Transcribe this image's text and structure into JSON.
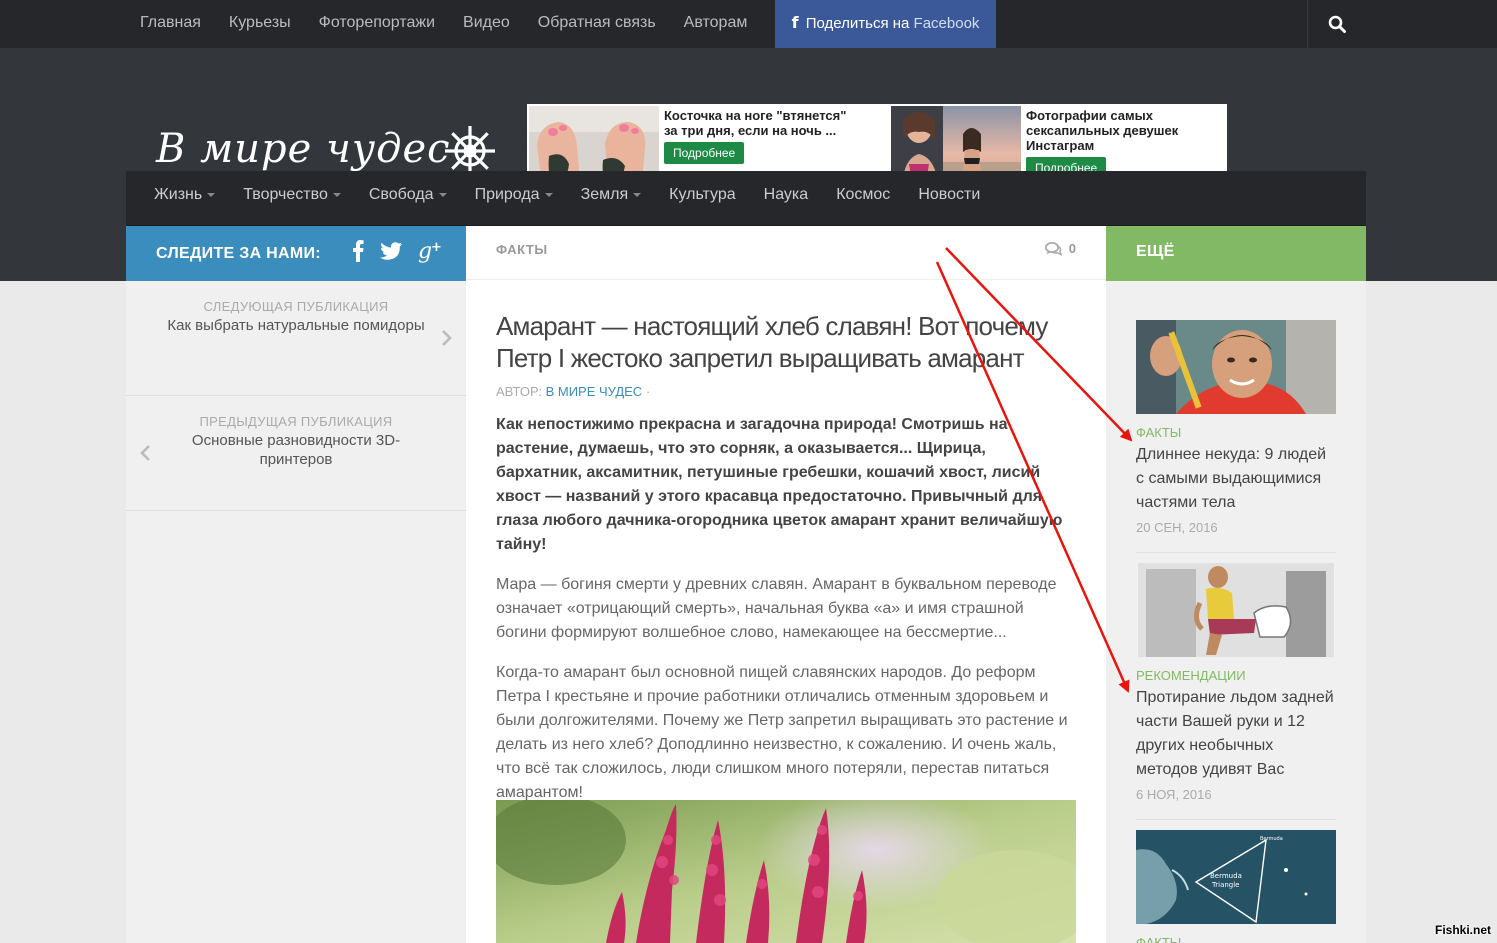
{
  "topnav": {
    "items": [
      "Главная",
      "Курьезы",
      "Фоторепортажи",
      "Видео",
      "Обратная связь",
      "Авторам"
    ],
    "share_prefix": "Поделиться на",
    "share_network": "Facebook"
  },
  "header": {
    "logo_text": "В мире чудес"
  },
  "ads": [
    {
      "title": "Косточка на ноге \"втянется\" за три дня, если на ночь ...",
      "button": "Подробнее"
    },
    {
      "title": "Фотографии самых сексапильных девушек Инстаграм",
      "button": "Подробнее"
    }
  ],
  "mainnav": {
    "items": [
      {
        "label": "Жизнь",
        "dropdown": true
      },
      {
        "label": "Творчество",
        "dropdown": true
      },
      {
        "label": "Свобода",
        "dropdown": true
      },
      {
        "label": "Природа",
        "dropdown": true
      },
      {
        "label": "Земля",
        "dropdown": true
      },
      {
        "label": "Культура",
        "dropdown": false
      },
      {
        "label": "Наука",
        "dropdown": false
      },
      {
        "label": "Космос",
        "dropdown": false
      },
      {
        "label": "Новости",
        "dropdown": false
      }
    ]
  },
  "left": {
    "follow_title": "СЛЕДИТЕ ЗА НАМИ:",
    "next_label": "СЛЕДУЮЩАЯ ПУБЛИКАЦИЯ",
    "next_title": "Как выбрать натуральные помидоры",
    "prev_label": "ПРЕДЫДУЩАЯ ПУБЛИКАЦИЯ",
    "prev_title": "Основные разновидности 3D-принтеров"
  },
  "article": {
    "category": "ФАКТЫ",
    "comments": "0",
    "title": "Амарант — настоящий хлеб славян! Вот почему Петр I жестоко запретил выращивать амарант",
    "author_prefix": "АВТОР:",
    "author": "В МИРЕ ЧУДЕС",
    "author_suffix": "·",
    "lead": "Как непостижимо прекрасна и загадочна природа! Смотришь на растение, думаешь, что это сорняк, а оказывается... Щирица, бархатник, аксамитник, петушиные гребешки, кошачий хвост, лисий хвост — названий у этого красавца предостаточно. Привычный для глаза любого дачника-огородника цветок амарант хранит величайшую тайну!",
    "p1": "Мара — богиня смерти у древних славян. Амарант в буквальном переводе означает «отрицающий смерть», начальная буква «а» и имя страшной богини формируют волшебное слово, намекающее на бессмертие...",
    "p2": "Когда-то амарант был основной пищей славянских народов. До реформ Петра I крестьяне и прочие работники отличались отменным здоровьем и были долгожителями. Почему же Петр запретил выращивать это растение и делать из него хлеб? Доподлинно неизвестно, к сожалению. И очень жаль, что всё так сложилось, люди слишком много потеряли, перестав питаться амарантом!"
  },
  "right": {
    "title": "ЕЩЁ",
    "items": [
      {
        "category": "ФАКТЫ",
        "title": "Длиннее некуда: 9 людей с самыми выдающимися частями тела",
        "date": "20 СЕН, 2016"
      },
      {
        "category": "РЕКОМЕНДАЦИИ",
        "title": "Протирание льдом задней части Вашей руки и 12 других необычных методов удивят Вас",
        "date": "6 НОЯ, 2016"
      },
      {
        "category": "ФАКТЫ",
        "thumb_text_1": "Bermuda",
        "thumb_text_2": "Triangle",
        "thumb_text_3": "Bermuda"
      }
    ]
  },
  "watermark": "Fishki.net",
  "colors": {
    "topbar": "#26272b",
    "header": "#33363b",
    "facebook": "#3b5998",
    "follow": "#3b8dbd",
    "more": "#82b965",
    "annotation_arrows": "#e8150f"
  }
}
